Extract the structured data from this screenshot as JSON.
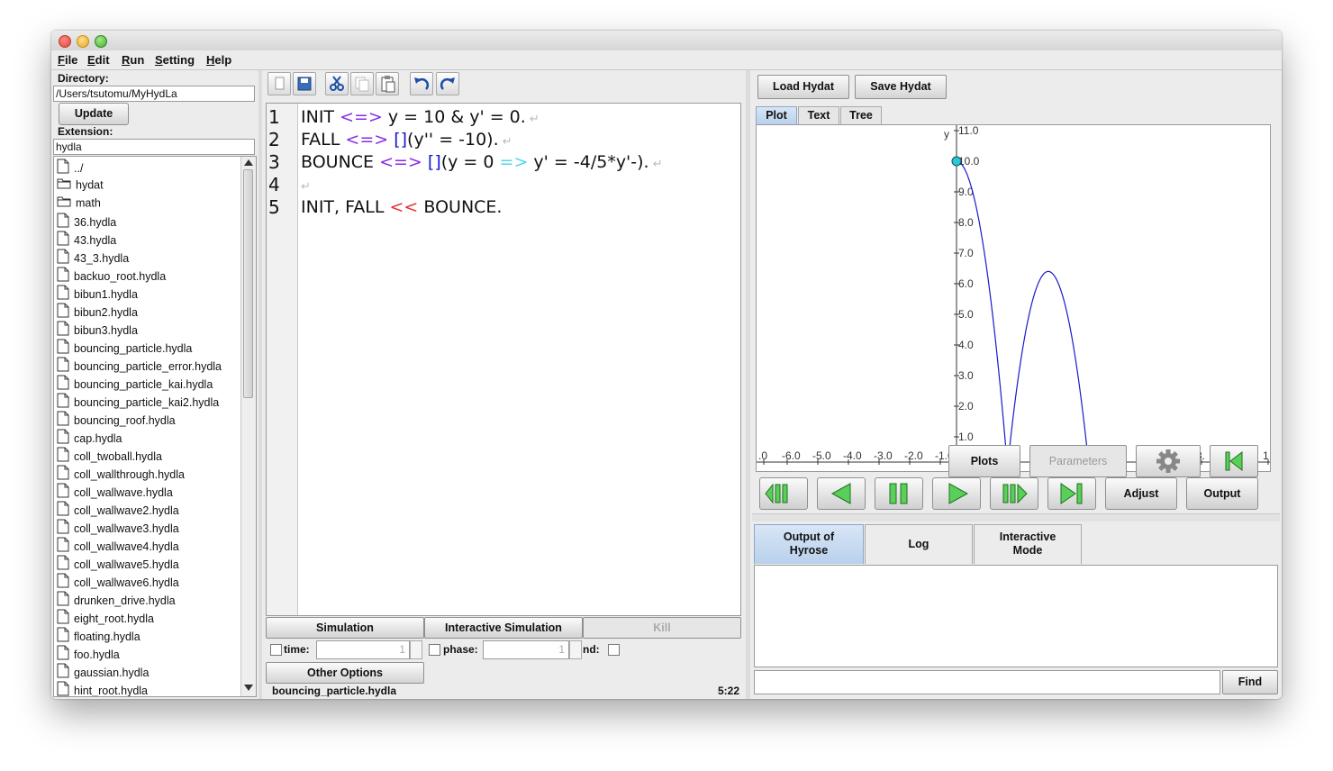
{
  "menu": {
    "items": [
      "File",
      "Edit",
      "Run",
      "Setting",
      "Help"
    ],
    "underline": [
      "F",
      "E",
      "R",
      "S",
      "H"
    ]
  },
  "left": {
    "directory_label": "Directory:",
    "directory_value": "/Users/tsutomu/MyHydLa",
    "update_label": "Update",
    "extension_label": "Extension:",
    "extension_value": "hydla",
    "files": [
      {
        "name": "../",
        "type": "file"
      },
      {
        "name": "hydat",
        "type": "folder"
      },
      {
        "name": "math",
        "type": "folder"
      },
      {
        "name": "36.hydla",
        "type": "file"
      },
      {
        "name": "43.hydla",
        "type": "file"
      },
      {
        "name": "43_3.hydla",
        "type": "file"
      },
      {
        "name": "backuo_root.hydla",
        "type": "file"
      },
      {
        "name": "bibun1.hydla",
        "type": "file"
      },
      {
        "name": "bibun2.hydla",
        "type": "file"
      },
      {
        "name": "bibun3.hydla",
        "type": "file"
      },
      {
        "name": "bouncing_particle.hydla",
        "type": "file"
      },
      {
        "name": "bouncing_particle_error.hydla",
        "type": "file"
      },
      {
        "name": "bouncing_particle_kai.hydla",
        "type": "file"
      },
      {
        "name": "bouncing_particle_kai2.hydla",
        "type": "file"
      },
      {
        "name": "bouncing_roof.hydla",
        "type": "file"
      },
      {
        "name": "cap.hydla",
        "type": "file"
      },
      {
        "name": "coll_twoball.hydla",
        "type": "file"
      },
      {
        "name": "coll_wallthrough.hydla",
        "type": "file"
      },
      {
        "name": "coll_wallwave.hydla",
        "type": "file"
      },
      {
        "name": "coll_wallwave2.hydla",
        "type": "file"
      },
      {
        "name": "coll_wallwave3.hydla",
        "type": "file"
      },
      {
        "name": "coll_wallwave4.hydla",
        "type": "file"
      },
      {
        "name": "coll_wallwave5.hydla",
        "type": "file"
      },
      {
        "name": "coll_wallwave6.hydla",
        "type": "file"
      },
      {
        "name": "drunken_drive.hydla",
        "type": "file"
      },
      {
        "name": "eight_root.hydla",
        "type": "file"
      },
      {
        "name": "floating.hydla",
        "type": "file"
      },
      {
        "name": "foo.hydla",
        "type": "file"
      },
      {
        "name": "gaussian.hydla",
        "type": "file"
      },
      {
        "name": "hint_root.hydla",
        "type": "file"
      }
    ]
  },
  "editor": {
    "toolbar_icons": [
      "new-file-icon",
      "save-icon",
      "cut-icon",
      "copy-icon",
      "paste-icon",
      "undo-icon",
      "redo-icon"
    ],
    "line_numbers": [
      "1",
      "2",
      "3",
      "4",
      "5"
    ],
    "lines": [
      [
        {
          "t": "INIT ",
          "c": "#111"
        },
        {
          "t": "<=>",
          "c": "#8a2be2"
        },
        {
          "t": " y = 10 & y' = 0.",
          "c": "#111"
        }
      ],
      [
        {
          "t": "FALL ",
          "c": "#111"
        },
        {
          "t": "<=>",
          "c": "#8a2be2"
        },
        {
          "t": " ",
          "c": "#111"
        },
        {
          "t": "[]",
          "c": "#1515d0"
        },
        {
          "t": "(y'' = -10).",
          "c": "#111"
        }
      ],
      [
        {
          "t": "BOUNCE ",
          "c": "#111"
        },
        {
          "t": "<=>",
          "c": "#8a2be2"
        },
        {
          "t": " ",
          "c": "#111"
        },
        {
          "t": "[]",
          "c": "#1515d0"
        },
        {
          "t": "(y = 0 ",
          "c": "#111"
        },
        {
          "t": "=>",
          "c": "#4fd8e8"
        },
        {
          "t": " y' = -4/5*y'-).",
          "c": "#111"
        }
      ],
      [],
      [
        {
          "t": "INIT, FALL ",
          "c": "#111"
        },
        {
          "t": "<<",
          "c": "#e83030"
        },
        {
          "t": " BOUNCE.",
          "c": "#111"
        }
      ]
    ],
    "simulation_label": "Simulation",
    "interactive_label": "Interactive Simulation",
    "kill_label": "Kill",
    "time_label": "time:",
    "time_value": "1",
    "phase_label": "phase:",
    "phase_value": "1",
    "nd_label": "nd:",
    "other_options_label": "Other Options",
    "status_file": "bouncing_particle.hydla",
    "status_pos": "5:22"
  },
  "right": {
    "load_label": "Load Hydat",
    "save_label": "Save Hydat",
    "tabs": [
      "Plot",
      "Text",
      "Tree"
    ],
    "active_tab": "Plot",
    "plot": {
      "y_axis_label": "y",
      "y_ticks": [
        "11.0",
        "10.0",
        "9.0",
        "8.0",
        "7.0",
        "6.0",
        "5.0",
        "4.0",
        "3.0",
        "2.0",
        "1.0"
      ],
      "x_ticks": [
        ".0",
        "-6.0",
        "-5.0",
        "-4.0",
        "-3.0",
        "-2.0",
        "-1.0",
        "8.",
        "1"
      ],
      "curve_color": "#1a1acc",
      "point_color": "#28c8d8"
    },
    "plots_label": "Plots",
    "parameters_label": "Parameters",
    "adjust_label": "Adjust",
    "output_label": "Output",
    "bottom_tabs": [
      {
        "line1": "Output of",
        "line2": "Hyrose"
      },
      {
        "line1": "Log",
        "line2": ""
      },
      {
        "line1": "Interactive",
        "line2": "Mode"
      }
    ],
    "find_label": "Find"
  }
}
